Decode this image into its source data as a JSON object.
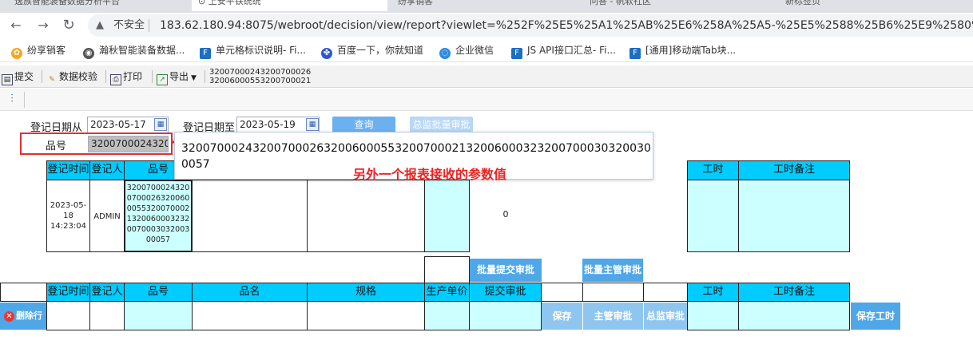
{
  "browser": {
    "tabs": [
      "逸族智能装备数据分析平台",
      "上安平铁统统",
      "纷享销客",
      "问答 - 帆软社区",
      "新标签页"
    ],
    "security_label": "不安全",
    "url": "183.62.180.94:8075/webroot/decision/view/report?viewlet=%252F%25E5%25A1%25AB%25E6%258A%25A5-%25E5%2588%25B6%25E9%2580%25A0%2..."
  },
  "bookmarks": [
    {
      "label": "纷享销客",
      "icon": "fxiaoke-icon"
    },
    {
      "label": "瀚秋智能装备数据...",
      "icon": "globe-icon"
    },
    {
      "label": "单元格标识说明- Fi...",
      "icon": "fr-icon"
    },
    {
      "label": "百度一下，你就知道",
      "icon": "baidu-icon"
    },
    {
      "label": "企业微信",
      "icon": "wecom-icon"
    },
    {
      "label": "JS API接口汇总- Fi...",
      "icon": "fr-icon"
    },
    {
      "label": "[通用]移动端Tab块...",
      "icon": "fr-icon"
    }
  ],
  "toolbar": {
    "submit": "提交",
    "validate": "数据校验",
    "print": "打印",
    "export": "导出",
    "param_preview": "32007000243200700026\n32006000553200700021"
  },
  "params": {
    "date_from_label": "登记日期从",
    "date_from": "2023-05-17",
    "date_to_label": "登记日期至",
    "date_to": "2023-05-19",
    "query_button": "查询",
    "bulk_director_button": "总监批量审批",
    "part_label": "品号",
    "part_value": "3200700024320070002632006000553200700021320060003232007000303200300057"
  },
  "tooltip_value": "3200700024320070002632006000553200700021320060003232007000303200300057",
  "annotation": "另外一个报表接收的参数值",
  "table1": {
    "headers": [
      "登记时间",
      "登记人",
      "品号",
      "工时",
      "工时备注"
    ],
    "row": {
      "time": "2023-05-18 14:23:04",
      "person": "ADMIN",
      "part": "3200700024320070002632006000553200700021320060003232007000303200300057",
      "value": "0"
    }
  },
  "table2": {
    "bulk_submit_button": "批量提交审批",
    "bulk_manager_button": "批量主管审批",
    "headers": [
      "登记时间",
      "登记人",
      "品号",
      "品名",
      "规格",
      "生产单价",
      "提交审批",
      "工时",
      "工时备注"
    ],
    "delete_row_button": "删除行",
    "save_button": "保存",
    "manager_approve_button": "主管审批",
    "director_approve_button": "总监审批",
    "save_hours_button": "保存工时"
  }
}
